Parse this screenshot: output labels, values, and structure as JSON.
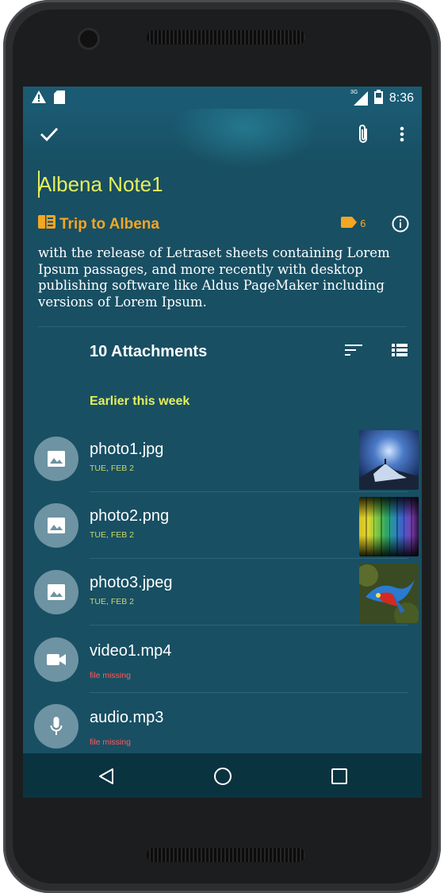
{
  "status": {
    "time": "8:36",
    "network": "3G",
    "icons": [
      "warning-icon",
      "sd-card-icon",
      "signal-icon",
      "battery-icon"
    ]
  },
  "toolbar": {
    "icons": [
      "check-icon",
      "attach-icon",
      "more-vert-icon"
    ]
  },
  "note": {
    "title": "Albena Note1",
    "notebook": "Trip to Albena",
    "tag_count": "6",
    "body": "with the release of Letraset sheets containing Lorem Ipsum passages, and more recently with desktop publishing software like Aldus PageMaker including versions of Lorem Ipsum."
  },
  "attachments": {
    "header": "10 Attachments",
    "section": "Earlier this week",
    "items": [
      {
        "name": "photo1.jpg",
        "sub": "TUE, FEB 2",
        "icon": "image-icon",
        "thumb": "mountain"
      },
      {
        "name": "photo2.png",
        "sub": "TUE, FEB 2",
        "icon": "image-icon",
        "thumb": "spectrum"
      },
      {
        "name": "photo3.jpeg",
        "sub": "TUE, FEB 2",
        "icon": "image-icon",
        "thumb": "parrot"
      },
      {
        "name": "video1.mp4",
        "sub": "file missing",
        "icon": "videocam-icon",
        "thumb": null
      },
      {
        "name": "audio.mp3",
        "sub": "file missing",
        "icon": "mic-icon",
        "thumb": null
      }
    ]
  },
  "colors": {
    "background": "#184f63",
    "accent_title": "#e5ee5a",
    "notebook": "#f5a623",
    "missing": "#ff5a5a"
  }
}
